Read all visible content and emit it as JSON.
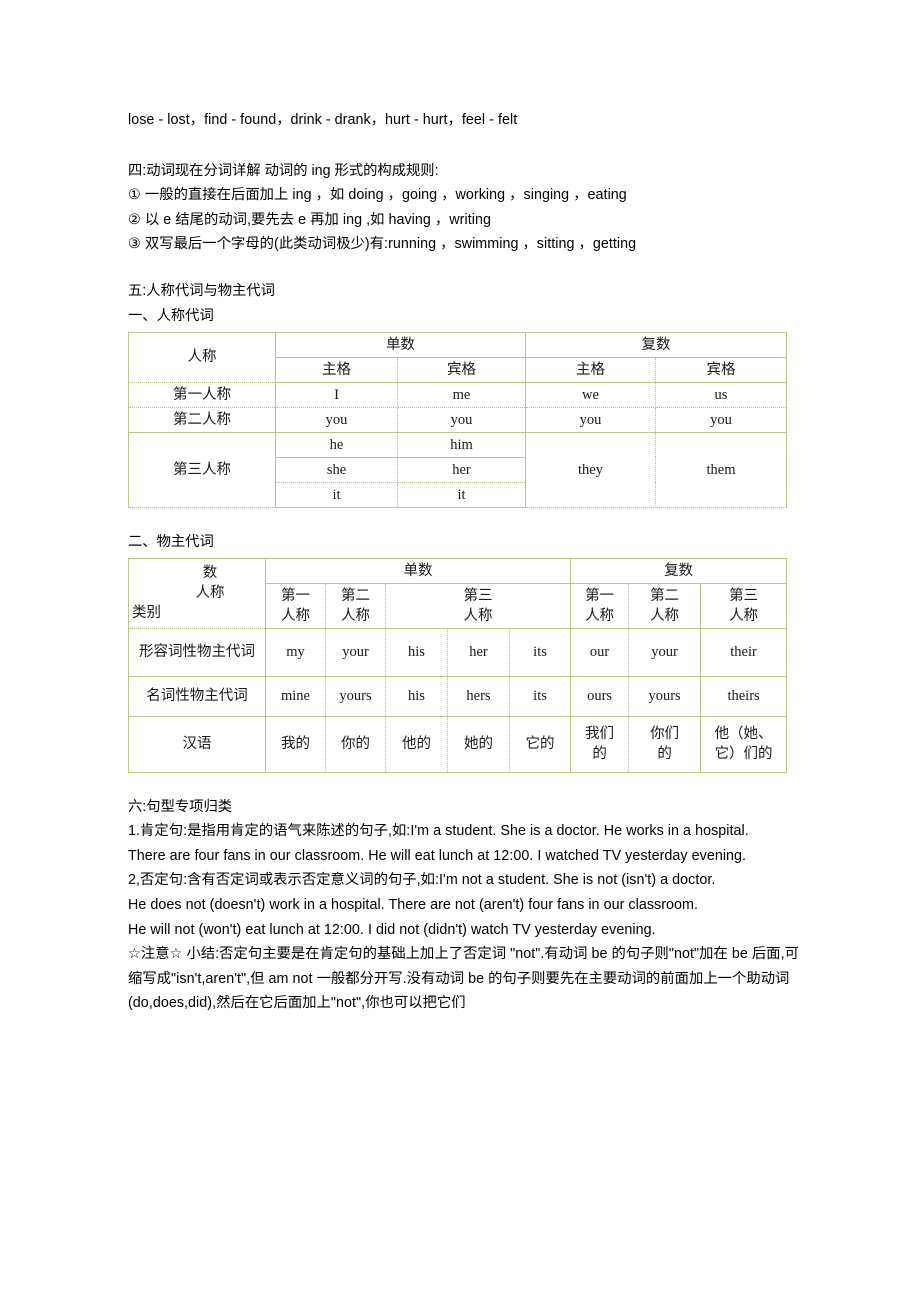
{
  "document": {
    "top_line": "lose - lost，find - found，drink - drank，hurt - hurt，feel - felt",
    "section_four": {
      "heading": "四:动词现在分词详解 动词的 ing 形式的构成规则:",
      "rules": [
        "①  一般的直接在后面加上 ing ，如 doing ，going ，working ，singing ，eating",
        "②  以 e  结尾的动词,要先去 e 再加 ing ,如 having ，writing",
        "③  双写最后一个字母的(此类动词极少)有:running ，swimming ，sitting ，getting"
      ]
    },
    "section_five": {
      "heading": "五:人称代词与物主代词",
      "sub_one": {
        "heading": "一、人称代词",
        "table": {
          "corner_label": "人称",
          "number_headers": [
            "单数",
            "复数"
          ],
          "case_headers": [
            "主格",
            "宾格",
            "主格",
            "宾格"
          ],
          "rows": [
            {
              "person": "第一人称",
              "cells": [
                "I",
                "me",
                "we",
                "us"
              ]
            },
            {
              "person": "第二人称",
              "cells": [
                "you",
                "you",
                "you",
                "you"
              ]
            }
          ],
          "third": {
            "person": "第三人称",
            "singular": [
              [
                "he",
                "him"
              ],
              [
                "she",
                "her"
              ],
              [
                "it",
                "it"
              ]
            ],
            "plural_subject": "they",
            "plural_object": "them"
          }
        }
      },
      "sub_two": {
        "heading": "二、物主代词",
        "table": {
          "corner": {
            "line1": "数",
            "line2": "人称",
            "line3": "类别"
          },
          "number_headers": [
            "单数",
            "复数"
          ],
          "person_headers_singular": [
            "第一\n人称",
            "第二\n人称",
            "第三\n人称"
          ],
          "person_headers_plural": [
            "第一\n人称",
            "第二\n人称",
            "第三\n人称"
          ],
          "rows": [
            {
              "label": "形容词性物主代词",
              "cells": [
                "my",
                "your",
                "his",
                "her",
                "its",
                "our",
                "your",
                "their"
              ]
            },
            {
              "label": "名词性物主代词",
              "cells": [
                "mine",
                "yours",
                "his",
                "hers",
                "its",
                "ours",
                "yours",
                "theirs"
              ]
            },
            {
              "label": "汉语",
              "cells": [
                "我的",
                "你的",
                "他的",
                "她的",
                "它的",
                "我们\n的",
                "你们\n的",
                "他（她、\n它）们的"
              ]
            }
          ]
        }
      }
    },
    "section_six": {
      "heading": "六:句型专项归类",
      "items": [
        "1.肯定句:是指用肯定的语气来陈述的句子,如:I'm a student. She is a doctor. He works in a hospital.",
        "There are four fans in our classroom. He will eat lunch at 12:00. I watched TV yesterday evening.",
        "2,否定句:含有否定词或表示否定意义词的句子,如:I'm not a student. She is not (isn't) a doctor.",
        "He does not (doesn't) work in a hospital. There are not (aren't) four fans in our classroom.",
        "He will not (won't) eat lunch at 12:00. I did not (didn't) watch TV yesterday evening.",
        "☆注意☆  小结:否定句主要是在肯定句的基础上加上了否定词  \"not\".有动词 be 的句子则\"not\"加在 be 后面,可缩写成\"isn't,aren't\",但 am not  一般都分开写.没有动词 be 的句子则要先在主要动词的前面加上一个助动词(do,does,did),然后在它后面加上\"not\",你也可以把它们"
      ]
    }
  },
  "colors": {
    "table_border": "#b4cd7d",
    "text": "#000000",
    "page_background": "#ffffff"
  }
}
